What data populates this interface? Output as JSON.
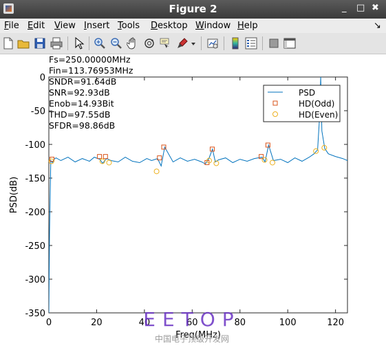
{
  "window": {
    "title": "Figure 2"
  },
  "window_controls": {
    "minimize": "_",
    "maximize": "□",
    "close": "✖"
  },
  "menu": [
    {
      "pre": "",
      "u": "F",
      "post": "ile"
    },
    {
      "pre": "",
      "u": "E",
      "post": "dit"
    },
    {
      "pre": "",
      "u": "V",
      "post": "iew"
    },
    {
      "pre": "",
      "u": "I",
      "post": "nsert"
    },
    {
      "pre": "",
      "u": "T",
      "post": "ools"
    },
    {
      "pre": "",
      "u": "D",
      "post": "esktop"
    },
    {
      "pre": "",
      "u": "W",
      "post": "indow"
    },
    {
      "pre": "",
      "u": "H",
      "post": "elp"
    }
  ],
  "menu_extra": "↘",
  "toolbar_icons": [
    "new-file-icon",
    "open-folder-icon",
    "save-icon",
    "print-icon",
    "pointer-icon",
    "zoom-in-icon",
    "zoom-out-icon",
    "pan-hand-icon",
    "rotate-3d-icon",
    "data-cursor-icon",
    "brush-icon",
    "brush-dropdown-icon",
    "link-plot-icon",
    "colorbar-icon",
    "legend-icon",
    "hide-plot-tools-icon",
    "show-plot-tools-icon"
  ],
  "plot_info": [
    "Fs=250.00000MHz",
    "Fin=113.76953MHz",
    "SNDR=91.64dB",
    "SNR=92.93dB",
    "Enob=14.93Bit",
    "THD=97.55dB",
    "SFDR=98.86dB"
  ],
  "watermark": {
    "main": "EETOP",
    "sub": "中国电子顶级开发网"
  },
  "colors": {
    "psd": "#0072bd",
    "odd": "#d95319",
    "even": "#edb120"
  },
  "chart_data": {
    "type": "line",
    "xlabel": "Freq(MHz)",
    "ylabel": "PSD(dB)",
    "xlim": [
      0,
      125
    ],
    "ylim": [
      -350,
      0
    ],
    "xticks": [
      0,
      20,
      40,
      60,
      80,
      100,
      120
    ],
    "yticks": [
      0,
      -50,
      -100,
      -150,
      -200,
      -250,
      -300,
      -350
    ],
    "legend_position": "top-right",
    "series": [
      {
        "name": "PSD",
        "style": "line",
        "noise_floor_db": -122,
        "x": [
          0,
          0.3,
          0.8,
          1.5,
          2.2,
          3,
          5,
          8,
          11,
          14,
          17,
          19,
          21.3,
          22.5,
          24.2,
          26,
          29,
          32,
          35,
          38,
          41,
          43,
          45.5,
          47,
          48.5,
          52,
          55,
          58,
          61,
          64,
          65.5,
          67,
          68.5,
          69.7,
          71,
          74,
          77,
          80,
          83,
          86,
          89.2,
          90.5,
          92,
          94,
          97,
          100,
          103,
          106,
          109,
          111,
          112.5,
          113.3,
          113.8,
          114.3,
          115.5,
          117,
          120,
          123,
          125
        ],
        "y": [
          -350,
          -230,
          -124,
          -127,
          -122,
          -120,
          -124,
          -119,
          -126,
          -121,
          -125,
          -119,
          -122,
          -128,
          -121,
          -124,
          -126,
          -119,
          -125,
          -127,
          -121,
          -124,
          -121,
          -132,
          -104,
          -126,
          -120,
          -125,
          -122,
          -126,
          -129,
          -121,
          -107,
          -126,
          -123,
          -120,
          -127,
          -122,
          -125,
          -121,
          -119,
          -126,
          -101,
          -124,
          -122,
          -127,
          -120,
          -125,
          -119,
          -114,
          -108,
          -60,
          0,
          -80,
          -106,
          -114,
          -118,
          -121,
          -124
        ]
      },
      {
        "name": "HD(Odd)",
        "style": "square",
        "x": [
          1.3,
          21.2,
          23.7,
          46.3,
          48.1,
          66.2,
          68.4,
          88.9,
          91.7
        ],
        "y": [
          -122,
          -118,
          -118,
          -120,
          -104,
          -127,
          -107,
          -118,
          -101
        ]
      },
      {
        "name": "HD(Even)",
        "style": "circle",
        "x": [
          1.1,
          22.4,
          25.2,
          45.1,
          67.1,
          70.1,
          90.3,
          93.6,
          111.8,
          115.3
        ],
        "y": [
          -125,
          -125,
          -127,
          -140,
          -124,
          -128,
          -123,
          -127,
          -110,
          -105
        ]
      }
    ]
  }
}
